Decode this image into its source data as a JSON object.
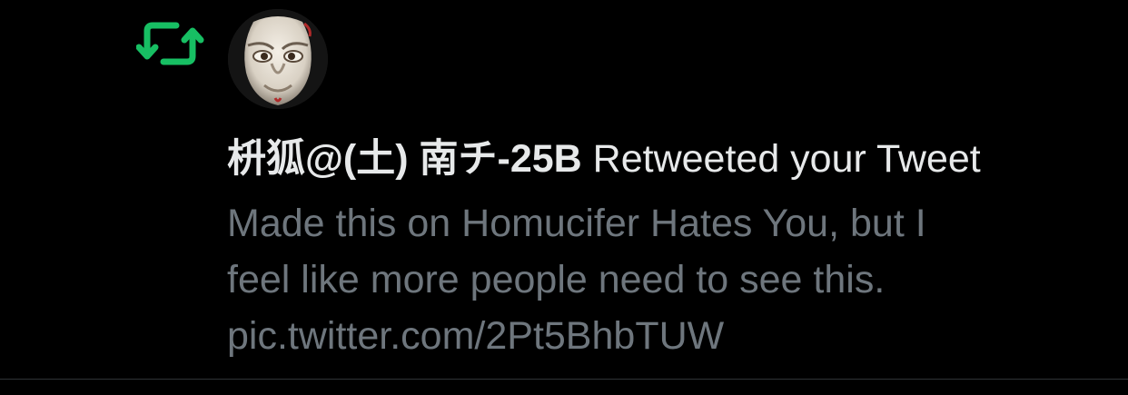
{
  "notification": {
    "icon": "retweet-icon",
    "icon_color": "#17bf63",
    "user_name": "枡狐@(土) 南チ-25B",
    "action_text": " Retweeted your Tweet",
    "tweet_lines": [
      "Made this on Homucifer Hates You, but I",
      "feel like more people need to see this.",
      "pic.twitter.com/2Pt5BhbTUW"
    ]
  },
  "colors": {
    "background": "#000000",
    "primary_text": "#e7e9ea",
    "secondary_text": "#6e767d",
    "divider": "#2f3336"
  }
}
